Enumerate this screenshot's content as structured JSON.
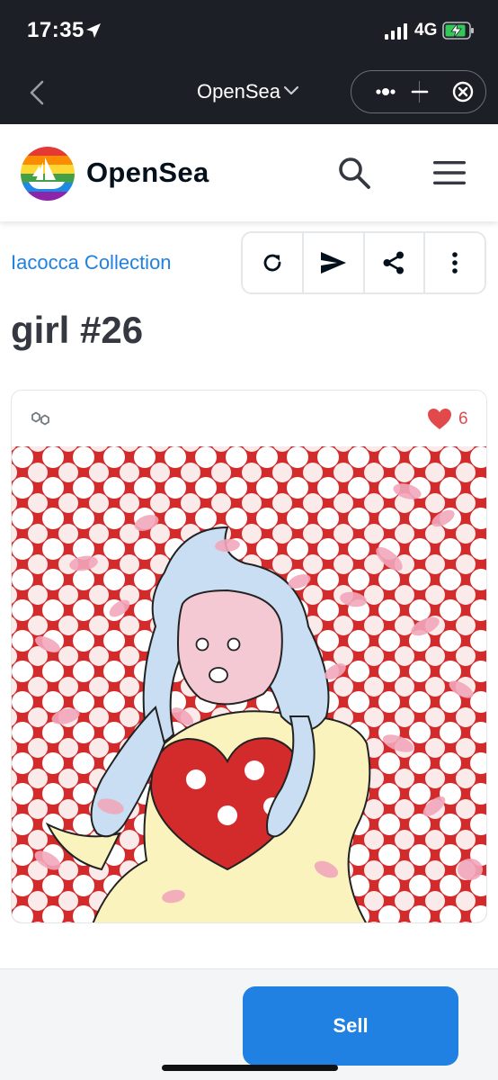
{
  "status_bar": {
    "time": "17:35",
    "network": "4G",
    "icons": [
      "location-arrow-icon",
      "signal-icon",
      "battery-charging-icon"
    ]
  },
  "mini_program_bar": {
    "title": "OpenSea",
    "icons": [
      "back-icon",
      "chevron-down-icon",
      "more-dots-icon",
      "minimize-icon",
      "close-icon"
    ]
  },
  "navbar": {
    "brand": "OpenSea",
    "icons": [
      "opensea-logo-icon",
      "search-icon",
      "menu-icon"
    ]
  },
  "item": {
    "collection": "Iacocca Collection",
    "title": "girl #26",
    "toolbar_icons": [
      "refresh-icon",
      "send-icon",
      "share-icon",
      "more-vertical-icon"
    ],
    "chain_icon": "polygon-icon",
    "favorites": "6",
    "accent": "#2081e2",
    "heart_color": "#e2494b"
  },
  "bottom": {
    "sell_label": "Sell"
  }
}
